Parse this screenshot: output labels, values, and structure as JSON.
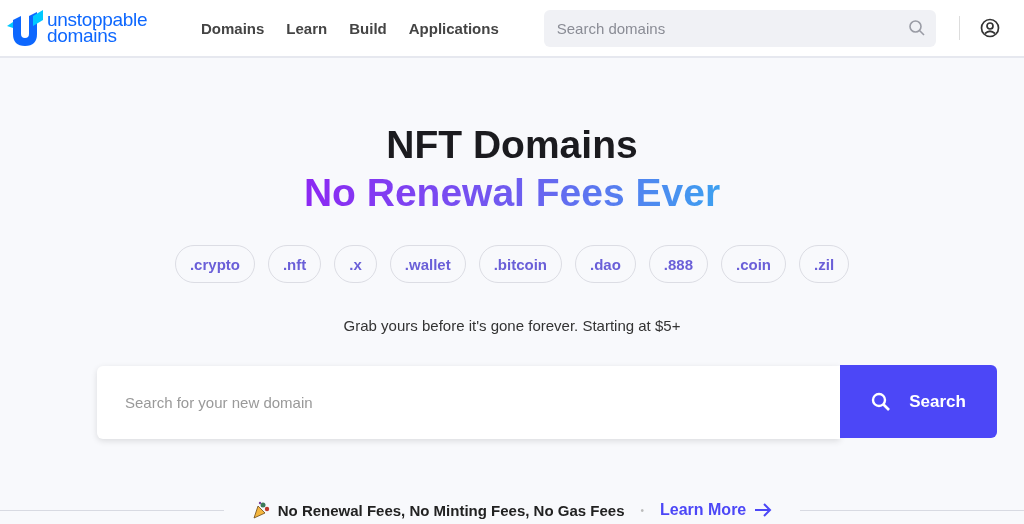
{
  "header": {
    "logo": {
      "line1": "unstoppable",
      "line2": "domains"
    },
    "nav": [
      {
        "label": "Domains"
      },
      {
        "label": "Learn"
      },
      {
        "label": "Build"
      },
      {
        "label": "Applications"
      }
    ],
    "search": {
      "placeholder": "Search domains"
    }
  },
  "hero": {
    "title": "NFT Domains",
    "subtitle": "No Renewal Fees Ever",
    "extensions": [
      {
        "label": ".crypto"
      },
      {
        "label": ".nft"
      },
      {
        "label": ".x"
      },
      {
        "label": ".wallet"
      },
      {
        "label": ".bitcoin"
      },
      {
        "label": ".dao"
      },
      {
        "label": ".888"
      },
      {
        "label": ".coin"
      },
      {
        "label": ".zil"
      }
    ],
    "tagline": "Grab yours before it's gone forever. Starting at $5+",
    "search": {
      "placeholder": "Search for your new domain",
      "button": "Search"
    }
  },
  "banner": {
    "text": "No Renewal Fees, No Minting Fees, No Gas Fees",
    "separator": "•",
    "link": "Learn More"
  }
}
